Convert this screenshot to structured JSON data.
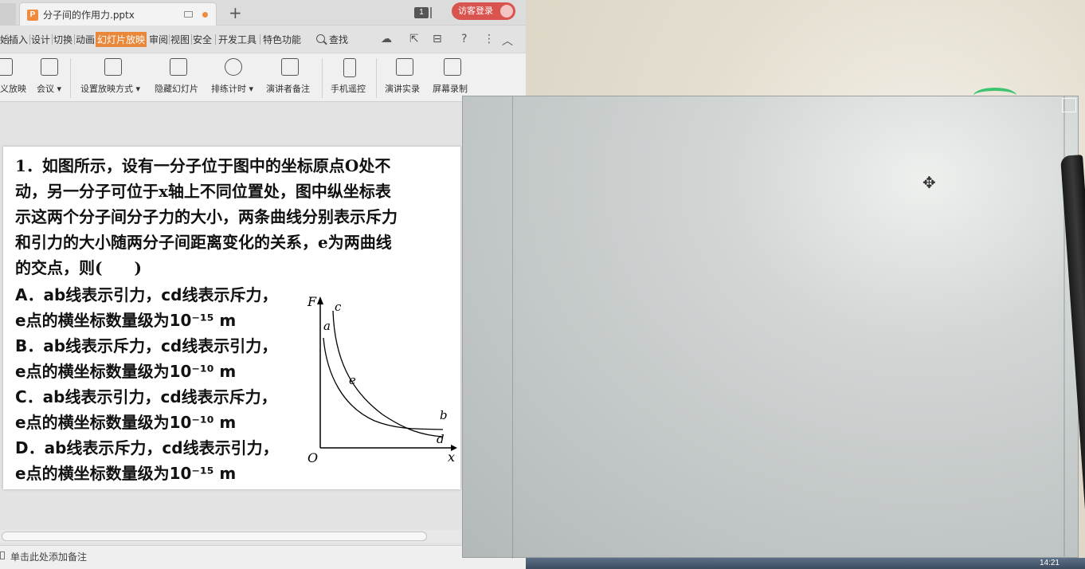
{
  "titlebar": {
    "file_icon_letter": "P",
    "tab_title": "分子间的作用力.pptx",
    "new_tab": "+",
    "window_count": "1",
    "login_label": "访客登录"
  },
  "menubar": {
    "items": [
      "始",
      "插入",
      "设计",
      "切换",
      "动画",
      "幻灯片放映",
      "审阅",
      "视图",
      "安全",
      "开发工具",
      "特色功能"
    ],
    "active_index": 5,
    "search_label": "查找",
    "help": "?",
    "more": "⋮",
    "collapse": "︿"
  },
  "ribbon": {
    "buttons": [
      "义放映",
      "会议",
      "设置放映方式",
      "隐藏幻灯片",
      "排练计时",
      "演讲者备注",
      "手机遥控",
      "演讲实录",
      "屏幕录制"
    ]
  },
  "slide": {
    "question_lines": [
      "1．如图所示，设有一分子位于图中的坐标原点O处不",
      "动，另一分子可位于x轴上不同位置处，图中纵坐标表",
      "示这两个分子间分子力的大小，两条曲线分别表示斥力",
      "和引力的大小随两分子间距离变化的关系，e为两曲线",
      "的交点，则(　　)"
    ],
    "option_lines": [
      "A．ab线表示引力，cd线表示斥力，",
      "e点的横坐标数量级为10⁻¹⁵ m",
      "B．ab线表示斥力，cd线表示引力，",
      "e点的横坐标数量级为10⁻¹⁰ m",
      "C．ab线表示引力，cd线表示斥力，",
      "e点的横坐标数量级为10⁻¹⁰ m",
      "D．ab线表示斥力，cd线表示引力，",
      "e点的横坐标数量级为10⁻¹⁵ m"
    ],
    "graph_labels": {
      "y_axis": "F",
      "x_axis": "x",
      "origin": "O",
      "a": "a",
      "b": "b",
      "c": "c",
      "d": "d",
      "e": "e"
    }
  },
  "notes": {
    "placeholder": "单击此处添加备注"
  },
  "taskbar": {
    "clock": "14:21"
  },
  "colors": {
    "accent": "#e9883b",
    "login": "#d9534f",
    "spinner": "#3cc46e"
  }
}
